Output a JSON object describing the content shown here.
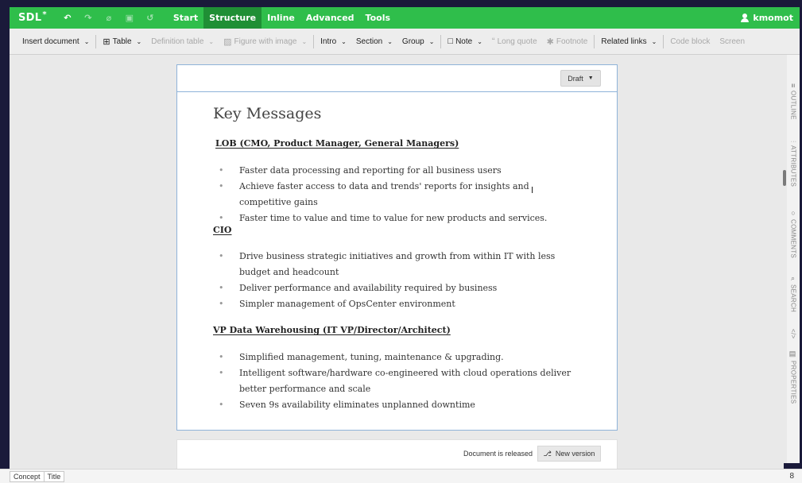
{
  "topbar": {
    "logo": "SDL",
    "logo_mark": "*",
    "menu": [
      {
        "label": "Start",
        "active": false
      },
      {
        "label": "Structure",
        "active": true
      },
      {
        "label": "Inline",
        "active": false
      },
      {
        "label": "Advanced",
        "active": false
      },
      {
        "label": "Tools",
        "active": false
      }
    ],
    "user": "kmomot",
    "accent_color": "#2fbe4b"
  },
  "toolbar": {
    "insert_document": "Insert document",
    "table": "Table",
    "definition_table": "Definition table",
    "figure_with_image": "Figure with image",
    "intro": "Intro",
    "section": "Section",
    "group": "Group",
    "note": "Note",
    "long_quote": "Long quote",
    "footnote": "Footnote",
    "related_links": "Related links",
    "code_block": "Code block",
    "screen": "Screen"
  },
  "card": {
    "status_button": "Draft",
    "title": "Key Messages",
    "sections": [
      {
        "heading": "LOB (CMO, Product Manager, General Managers)",
        "items": [
          "Faster data processing and reporting for all business users",
          "Achieve faster access to data and trends' reports for insights and competitive gains",
          "Faster time to value and time to value for new products and services."
        ]
      },
      {
        "heading": "CIO",
        "items": [
          "Drive business strategic initiatives and growth from within IT with less budget and headcount",
          "Deliver performance and availability required by business",
          "Simpler management of OpsCenter environment"
        ]
      },
      {
        "heading": "VP Data Warehousing (IT VP/Director/Architect)",
        "items": [
          "Simplified management, tuning, maintenance & upgrading.",
          "Intelligent software/hardware co-engineered with cloud operations deliver better performance and scale",
          "Seven 9s availability eliminates unplanned downtime"
        ]
      }
    ]
  },
  "footer_card": {
    "status_text": "Document is released",
    "new_version": "New version"
  },
  "right_panel": {
    "outline": "OUTLINE",
    "attributes": "ATTRIBUTES",
    "comments": "COMMENTS",
    "search": "SEARCH",
    "code": "</>",
    "properties": "PROPERTIES"
  },
  "statusbar": {
    "breadcrumb": [
      "Concept",
      "Title"
    ],
    "right_indicator": "8"
  }
}
